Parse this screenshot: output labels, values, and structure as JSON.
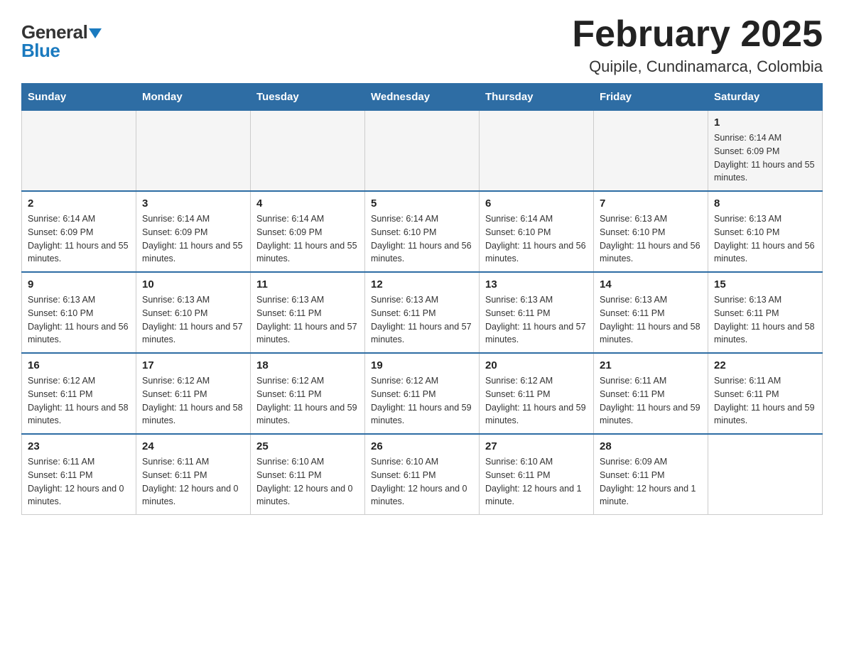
{
  "header": {
    "logo_general": "General",
    "logo_blue": "Blue",
    "month_title": "February 2025",
    "location": "Quipile, Cundinamarca, Colombia"
  },
  "days_of_week": [
    "Sunday",
    "Monday",
    "Tuesday",
    "Wednesday",
    "Thursday",
    "Friday",
    "Saturday"
  ],
  "weeks": [
    {
      "days": [
        {
          "number": "",
          "info": ""
        },
        {
          "number": "",
          "info": ""
        },
        {
          "number": "",
          "info": ""
        },
        {
          "number": "",
          "info": ""
        },
        {
          "number": "",
          "info": ""
        },
        {
          "number": "",
          "info": ""
        },
        {
          "number": "1",
          "info": "Sunrise: 6:14 AM\nSunset: 6:09 PM\nDaylight: 11 hours and 55 minutes."
        }
      ]
    },
    {
      "days": [
        {
          "number": "2",
          "info": "Sunrise: 6:14 AM\nSunset: 6:09 PM\nDaylight: 11 hours and 55 minutes."
        },
        {
          "number": "3",
          "info": "Sunrise: 6:14 AM\nSunset: 6:09 PM\nDaylight: 11 hours and 55 minutes."
        },
        {
          "number": "4",
          "info": "Sunrise: 6:14 AM\nSunset: 6:09 PM\nDaylight: 11 hours and 55 minutes."
        },
        {
          "number": "5",
          "info": "Sunrise: 6:14 AM\nSunset: 6:10 PM\nDaylight: 11 hours and 56 minutes."
        },
        {
          "number": "6",
          "info": "Sunrise: 6:14 AM\nSunset: 6:10 PM\nDaylight: 11 hours and 56 minutes."
        },
        {
          "number": "7",
          "info": "Sunrise: 6:13 AM\nSunset: 6:10 PM\nDaylight: 11 hours and 56 minutes."
        },
        {
          "number": "8",
          "info": "Sunrise: 6:13 AM\nSunset: 6:10 PM\nDaylight: 11 hours and 56 minutes."
        }
      ]
    },
    {
      "days": [
        {
          "number": "9",
          "info": "Sunrise: 6:13 AM\nSunset: 6:10 PM\nDaylight: 11 hours and 56 minutes."
        },
        {
          "number": "10",
          "info": "Sunrise: 6:13 AM\nSunset: 6:10 PM\nDaylight: 11 hours and 57 minutes."
        },
        {
          "number": "11",
          "info": "Sunrise: 6:13 AM\nSunset: 6:11 PM\nDaylight: 11 hours and 57 minutes."
        },
        {
          "number": "12",
          "info": "Sunrise: 6:13 AM\nSunset: 6:11 PM\nDaylight: 11 hours and 57 minutes."
        },
        {
          "number": "13",
          "info": "Sunrise: 6:13 AM\nSunset: 6:11 PM\nDaylight: 11 hours and 57 minutes."
        },
        {
          "number": "14",
          "info": "Sunrise: 6:13 AM\nSunset: 6:11 PM\nDaylight: 11 hours and 58 minutes."
        },
        {
          "number": "15",
          "info": "Sunrise: 6:13 AM\nSunset: 6:11 PM\nDaylight: 11 hours and 58 minutes."
        }
      ]
    },
    {
      "days": [
        {
          "number": "16",
          "info": "Sunrise: 6:12 AM\nSunset: 6:11 PM\nDaylight: 11 hours and 58 minutes."
        },
        {
          "number": "17",
          "info": "Sunrise: 6:12 AM\nSunset: 6:11 PM\nDaylight: 11 hours and 58 minutes."
        },
        {
          "number": "18",
          "info": "Sunrise: 6:12 AM\nSunset: 6:11 PM\nDaylight: 11 hours and 59 minutes."
        },
        {
          "number": "19",
          "info": "Sunrise: 6:12 AM\nSunset: 6:11 PM\nDaylight: 11 hours and 59 minutes."
        },
        {
          "number": "20",
          "info": "Sunrise: 6:12 AM\nSunset: 6:11 PM\nDaylight: 11 hours and 59 minutes."
        },
        {
          "number": "21",
          "info": "Sunrise: 6:11 AM\nSunset: 6:11 PM\nDaylight: 11 hours and 59 minutes."
        },
        {
          "number": "22",
          "info": "Sunrise: 6:11 AM\nSunset: 6:11 PM\nDaylight: 11 hours and 59 minutes."
        }
      ]
    },
    {
      "days": [
        {
          "number": "23",
          "info": "Sunrise: 6:11 AM\nSunset: 6:11 PM\nDaylight: 12 hours and 0 minutes."
        },
        {
          "number": "24",
          "info": "Sunrise: 6:11 AM\nSunset: 6:11 PM\nDaylight: 12 hours and 0 minutes."
        },
        {
          "number": "25",
          "info": "Sunrise: 6:10 AM\nSunset: 6:11 PM\nDaylight: 12 hours and 0 minutes."
        },
        {
          "number": "26",
          "info": "Sunrise: 6:10 AM\nSunset: 6:11 PM\nDaylight: 12 hours and 0 minutes."
        },
        {
          "number": "27",
          "info": "Sunrise: 6:10 AM\nSunset: 6:11 PM\nDaylight: 12 hours and 1 minute."
        },
        {
          "number": "28",
          "info": "Sunrise: 6:09 AM\nSunset: 6:11 PM\nDaylight: 12 hours and 1 minute."
        },
        {
          "number": "",
          "info": ""
        }
      ]
    }
  ]
}
